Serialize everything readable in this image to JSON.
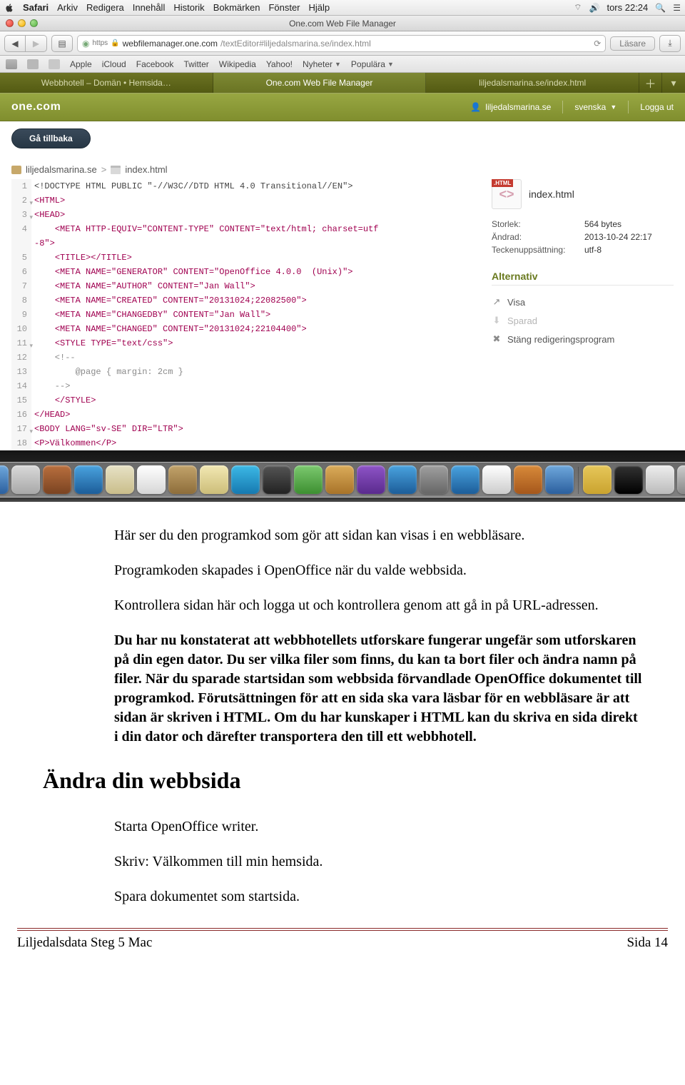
{
  "menubar": {
    "app": "Safari",
    "items": [
      "Arkiv",
      "Redigera",
      "Innehåll",
      "Historik",
      "Bokmärken",
      "Fönster",
      "Hjälp"
    ],
    "clock": "tors 22:24"
  },
  "window": {
    "title": "One.com Web File Manager"
  },
  "url": {
    "scheme": "https",
    "host": "webfilemanager.one.com",
    "path": "/textEditor#liljedalsmarina.se/index.html",
    "reader": "Läsare"
  },
  "bookmarks": [
    "Apple",
    "iCloud",
    "Facebook",
    "Twitter",
    "Wikipedia",
    "Yahoo!",
    "Nyheter",
    "Populära"
  ],
  "tabs": {
    "t1": "Webbhotell – Domän • Hemsida…",
    "t2": "One.com Web File Manager",
    "t3": "liljedalsmarina.se/index.html"
  },
  "onebar": {
    "brand": "one.com",
    "user": "liljedalsmarina.se",
    "lang": "svenska",
    "logout": "Logga ut"
  },
  "back_btn": "Gå tillbaka",
  "breadcrumb": {
    "root": "liljedalsmarina.se",
    "file": "index.html"
  },
  "code": {
    "l1": "<!DOCTYPE HTML PUBLIC \"-//W3C//DTD HTML 4.0 Transitional//EN\">",
    "l4a": "<META HTTP-EQUIV=\"CONTENT-TYPE\" CONTENT=\"text/html; charset=utf",
    "l4b": "-8\">",
    "l6": "<META NAME=\"GENERATOR\" CONTENT=\"OpenOffice 4.0.0  (Unix)\">",
    "l7": "<META NAME=\"AUTHOR\" CONTENT=\"Jan Wall\">",
    "l8": "<META NAME=\"CREATED\" CONTENT=\"20131024;22082500\">",
    "l9": "<META NAME=\"CHANGEDBY\" CONTENT=\"Jan Wall\">",
    "l10": "<META NAME=\"CHANGED\" CONTENT=\"20131024;22104400\">",
    "l11": "<STYLE TYPE=\"text/css\">",
    "l13": "@page { margin: 2cm }",
    "l17": "<BODY LANG=\"sv-SE\" DIR=\"LTR\">",
    "l18": "<P>Välkommen</P>"
  },
  "sidebar": {
    "badge": ".HTML",
    "filename": "index.html",
    "size_lbl": "Storlek:",
    "size_val": "564 bytes",
    "mod_lbl": "Ändrad:",
    "mod_val": "2013-10-24 22:17",
    "enc_lbl": "Teckenuppsättning:",
    "enc_val": "utf-8",
    "alt_hdr": "Alternativ",
    "visa": "Visa",
    "sparad": "Sparad",
    "close": "Stäng redigeringsprogram"
  },
  "doc": {
    "p1": "Här ser du den programkod som gör att sidan kan visas i en webbläsare.",
    "p2": "Programkoden skapades i OpenOffice när du valde webbsida.",
    "p3": "Kontrollera sidan här och logga ut och kontrollera genom att gå in på URL-adressen.",
    "p4": "Du har nu konstaterat att webbhotellets utforskare fungerar ungefär som utforskaren på din egen dator. Du ser vilka filer som finns, du kan ta bort filer och ändra namn på filer. När du sparade startsidan som webbsida förvandlade OpenOffice dokumentet till programkod. Förutsättningen för att en sida ska vara läsbar för en webbläsare är att sidan är skriven i HTML. Om du har kunskaper i HTML kan du skriva en sida direkt i din dator och därefter transportera den till ett webbhotell.",
    "h2": "Ändra din webbsida",
    "p5": "Starta OpenOffice writer.",
    "p6": "Skriv: Välkommen till min hemsida.",
    "p7": "Spara dokumentet som startsida."
  },
  "footer": {
    "left": "Liljedalsdata Steg 5 Mac",
    "right": "Sida 14"
  }
}
